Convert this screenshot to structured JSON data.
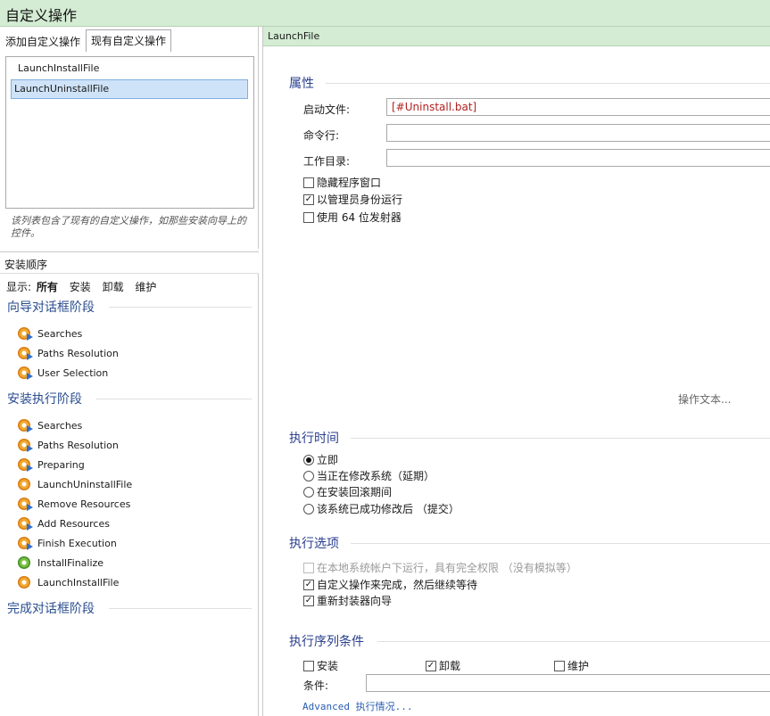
{
  "window": {
    "title": "自定义操作"
  },
  "tabs": [
    {
      "label": "添加自定义操作"
    },
    {
      "label": "现有自定义操作"
    }
  ],
  "action_list": {
    "items": [
      {
        "label": "LaunchInstallFile",
        "selected": false
      },
      {
        "label": "LaunchUninstallFile",
        "selected": true
      }
    ],
    "hint": "该列表包含了现有的自定义操作，如那些安装向导上的控件。"
  },
  "sequence": {
    "header": "安装顺序",
    "filter": {
      "prefix": "显示:",
      "options": [
        "所有",
        "安装",
        "卸载",
        "维护"
      ],
      "active": "所有"
    },
    "phases": [
      {
        "title": "向导对话框阶段",
        "steps": [
          "Searches",
          "Paths Resolution",
          "User Selection"
        ]
      },
      {
        "title": "安装执行阶段",
        "steps": [
          "Searches",
          "Paths Resolution",
          "Preparing",
          "LaunchUninstallFile",
          "Remove Resources",
          "Add Resources",
          "Finish Execution",
          "InstallFinalize",
          "LaunchInstallFile"
        ]
      },
      {
        "title": "完成对话框阶段",
        "steps": []
      }
    ]
  },
  "detail": {
    "header": "LaunchFile",
    "properties": {
      "title": "属性",
      "launch_file_label": "启动文件:",
      "launch_file_value": "[#Uninstall.bat]",
      "cmdline_label": "命令行:",
      "cmdline_value": "",
      "workdir_label": "工作目录:",
      "workdir_value": "",
      "checks": [
        {
          "label": "隐藏程序窗口",
          "checked": false
        },
        {
          "label": "以管理员身份运行",
          "checked": true
        },
        {
          "label": "使用 64 位发射器",
          "checked": false
        }
      ],
      "action_text_link": "操作文本..."
    },
    "timing": {
      "title": "执行时间",
      "options": [
        {
          "label": "立即",
          "selected": true
        },
        {
          "label": "当正在修改系统（延期）",
          "selected": false
        },
        {
          "label": "在安装回滚期间",
          "selected": false
        },
        {
          "label": "该系统已成功修改后 （提交）",
          "selected": false
        }
      ]
    },
    "exec_options": {
      "title": "执行选项",
      "checks": [
        {
          "label": "在本地系统帐户下运行，具有完全权限 （没有模拟等）",
          "checked": false,
          "disabled": true
        },
        {
          "label": "自定义操作来完成，然后继续等待",
          "checked": true,
          "disabled": false
        },
        {
          "label": "重新封装器向导",
          "checked": true,
          "disabled": false
        }
      ]
    },
    "conditions": {
      "title": "执行序列条件",
      "checks": [
        {
          "label": "安装",
          "checked": false
        },
        {
          "label": "卸载",
          "checked": true
        },
        {
          "label": "维护",
          "checked": false
        }
      ],
      "condition_label": "条件:",
      "condition_value": "",
      "advanced_link": "Advanced 执行情况..."
    }
  }
}
